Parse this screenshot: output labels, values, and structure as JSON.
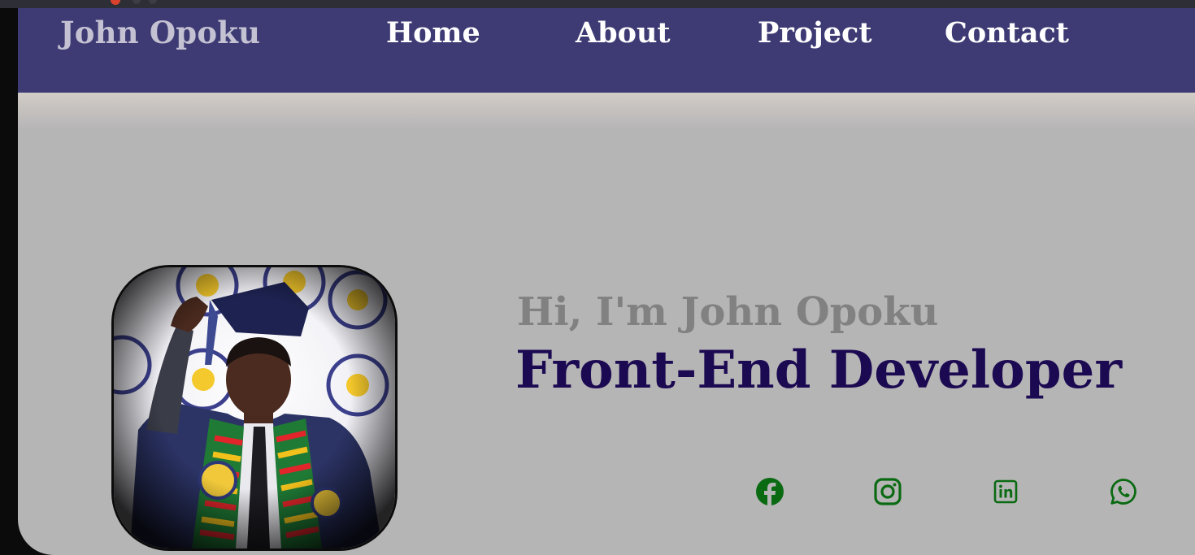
{
  "header": {
    "brand": "John Opoku",
    "nav": [
      "Home",
      "About",
      "Project",
      "Contact"
    ]
  },
  "hero": {
    "greeting": "Hi, I'm John Opoku",
    "role": "Front-End Developer",
    "photo": "profile-photo"
  },
  "social": [
    {
      "icon": "facebook-icon"
    },
    {
      "icon": "instagram-icon"
    },
    {
      "icon": "linkedin-icon"
    },
    {
      "icon": "whatsapp-icon"
    }
  ],
  "colors": {
    "navbar": "#3e3b74",
    "brand": "#c4c1d3",
    "nav_link": "#ffffff",
    "background": "#b6b5b6",
    "greeting": "#818181",
    "role": "#1b0a52",
    "social_icon": "#0a6a12"
  }
}
